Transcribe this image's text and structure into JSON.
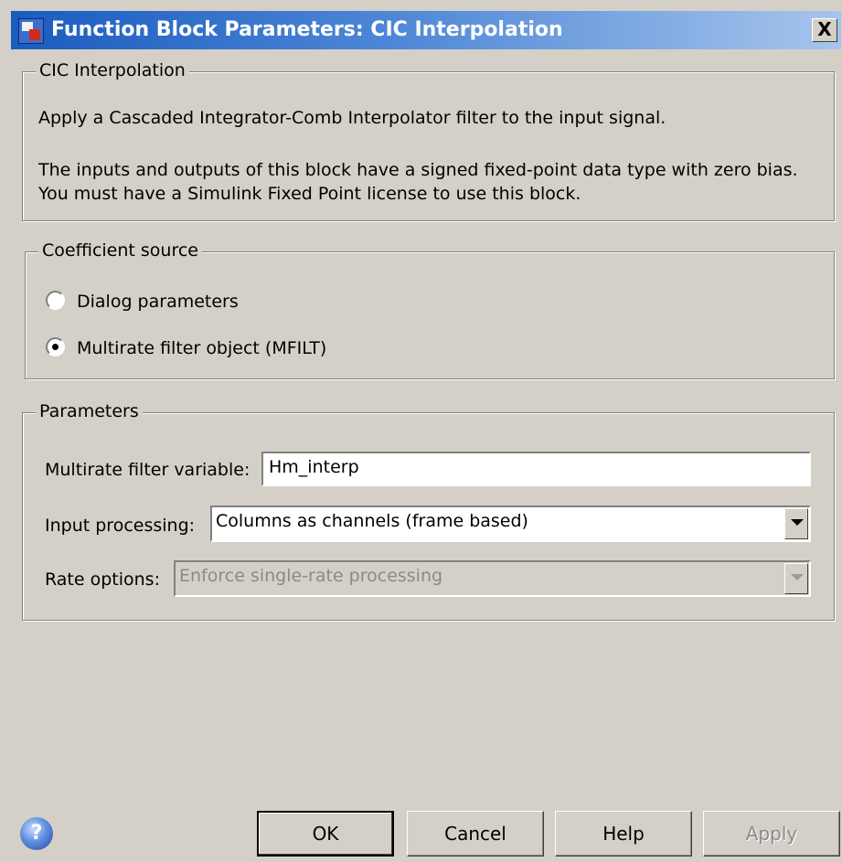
{
  "window": {
    "title": "Function Block Parameters: CIC Interpolation",
    "close_glyph": "X"
  },
  "description": {
    "group_label": "CIC Interpolation",
    "line1": "Apply a Cascaded Integrator-Comb Interpolator filter to the input signal.",
    "line2": "The inputs and outputs of this block have a signed fixed-point data type with zero bias.",
    "line3": "You must have a Simulink Fixed Point license to use this block."
  },
  "coefficient_source": {
    "group_label": "Coefficient source",
    "options": [
      {
        "label": "Dialog parameters",
        "selected": false
      },
      {
        "label": "Multirate filter object (MFILT)",
        "selected": true
      }
    ]
  },
  "parameters": {
    "group_label": "Parameters",
    "filter_variable_label": "Multirate filter variable:",
    "filter_variable_value": "Hm_interp",
    "input_processing_label": "Input processing:",
    "input_processing_value": "Columns as channels (frame based)",
    "rate_options_label": "Rate options:",
    "rate_options_value": "Enforce single-rate processing"
  },
  "buttons": {
    "help_icon_glyph": "?",
    "ok": "OK",
    "cancel": "Cancel",
    "help": "Help",
    "apply": "Apply"
  },
  "icons": {
    "app": "simulink-block-icon",
    "help": "question-circle-icon",
    "close": "close-icon",
    "dropdown": "chevron-down-icon"
  }
}
